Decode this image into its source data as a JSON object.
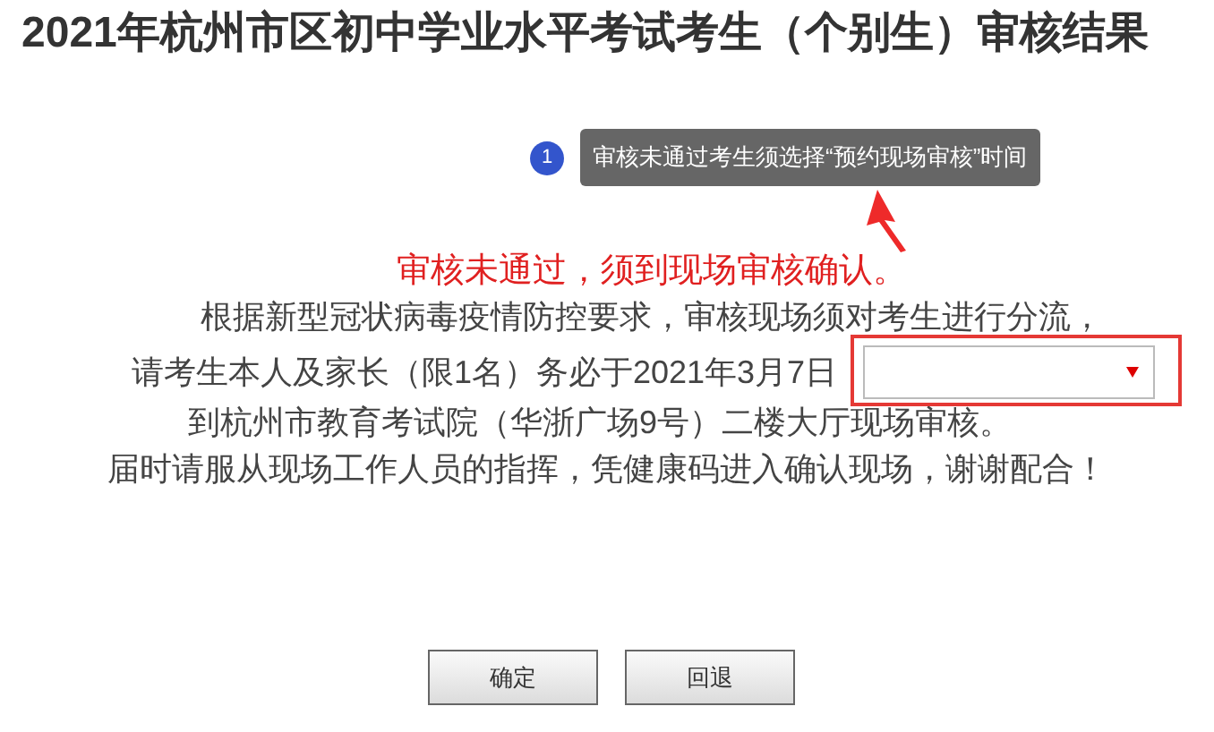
{
  "title": "2021年杭州市区初中学业水平考试考生（个别生）审核结果",
  "annotation": {
    "badge": "1",
    "tooltip": "审核未通过考生须选择“预约现场审核”时间"
  },
  "notice": "审核未通过，须到现场审核确认。",
  "lines": [
    {
      "kind": "text",
      "text": "根据新型冠状病毒疫情防控要求，审核现场须对考生进行分流，"
    },
    {
      "kind": "select",
      "text": "请考生本人及家长（限1名）务必于2021年3月7日"
    },
    {
      "kind": "text",
      "text": "到杭州市教育考试院（华浙广场9号）二楼大厅现场审核。"
    },
    {
      "kind": "text",
      "text": "届时请服从现场工作人员的指挥，凭健康码进入确认现场，谢谢配合！"
    }
  ],
  "buttons": [
    "确定",
    "回退"
  ]
}
